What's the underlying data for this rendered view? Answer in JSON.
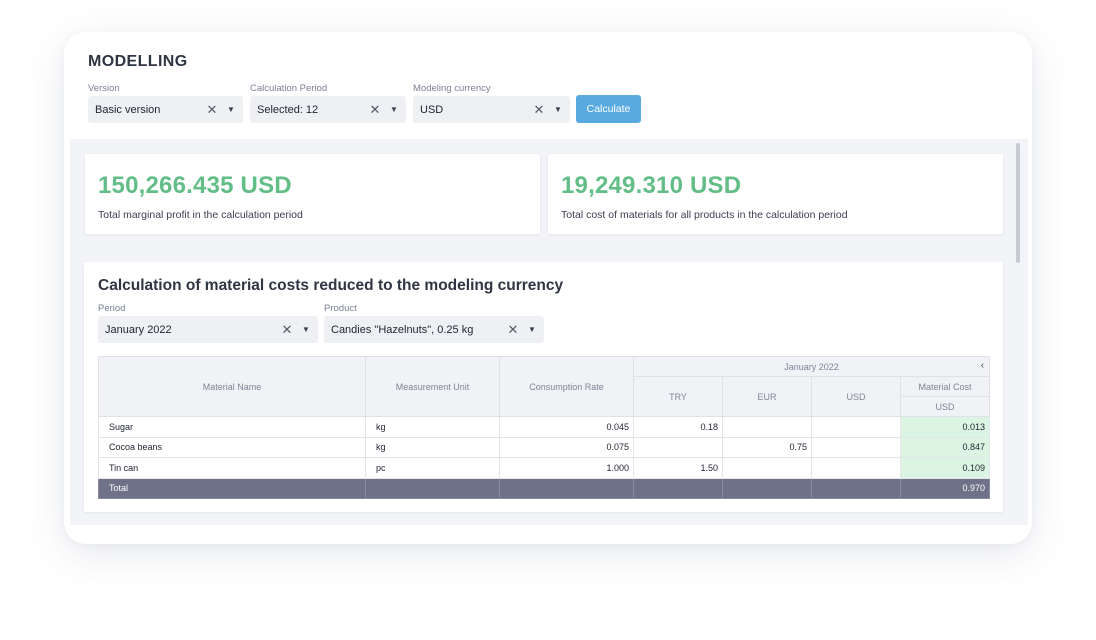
{
  "app": {
    "title": "MODELLING"
  },
  "filters": {
    "version": {
      "label": "Version",
      "value": "Basic version"
    },
    "calc_period": {
      "label": "Calculation Period",
      "value": "Selected: 12"
    },
    "currency": {
      "label": "Modeling currency",
      "value": "USD"
    },
    "calculate_label": "Calculate"
  },
  "kpis": [
    {
      "value": "150,266.435 USD",
      "description": "Total marginal profit in the calculation period"
    },
    {
      "value": "19,249.310 USD",
      "description": "Total cost of materials for all products in the calculation period"
    }
  ],
  "panel": {
    "title": "Calculation of material costs reduced to the modeling currency",
    "period": {
      "label": "Period",
      "value": "January 2022"
    },
    "product": {
      "label": "Product",
      "value": "Candies \"Hazelnuts\", 0.25 kg"
    }
  },
  "table": {
    "headers": {
      "material_name": "Material Name",
      "unit": "Measurement Unit",
      "rate": "Consumption Rate",
      "period_group": "January 2022",
      "try": "TRY",
      "eur": "EUR",
      "usd": "USD",
      "material_cost": "Material Cost",
      "material_cost_currency": "USD"
    },
    "rows": [
      {
        "name": "Sugar",
        "unit": "kg",
        "rate": "0.045",
        "try": "0.18",
        "eur": "",
        "usd": "",
        "cost": "0.013"
      },
      {
        "name": "Cocoa beans",
        "unit": "kg",
        "rate": "0.075",
        "try": "",
        "eur": "0.75",
        "usd": "",
        "cost": "0.847"
      },
      {
        "name": "Tin can",
        "unit": "pc",
        "rate": "1.000",
        "try": "1.50",
        "eur": "",
        "usd": "",
        "cost": "0.109"
      }
    ],
    "total": {
      "label": "Total",
      "cost": "0.970"
    }
  },
  "icons": {
    "clear": "close-icon",
    "dropdown": "caret-down-icon",
    "collapse": "chevron-left-icon"
  },
  "colors": {
    "accent": "#5aaae2",
    "kpi_value": "#62bd86",
    "highlight_cell": "#dcf5e3",
    "total_row": "#6f7189"
  }
}
